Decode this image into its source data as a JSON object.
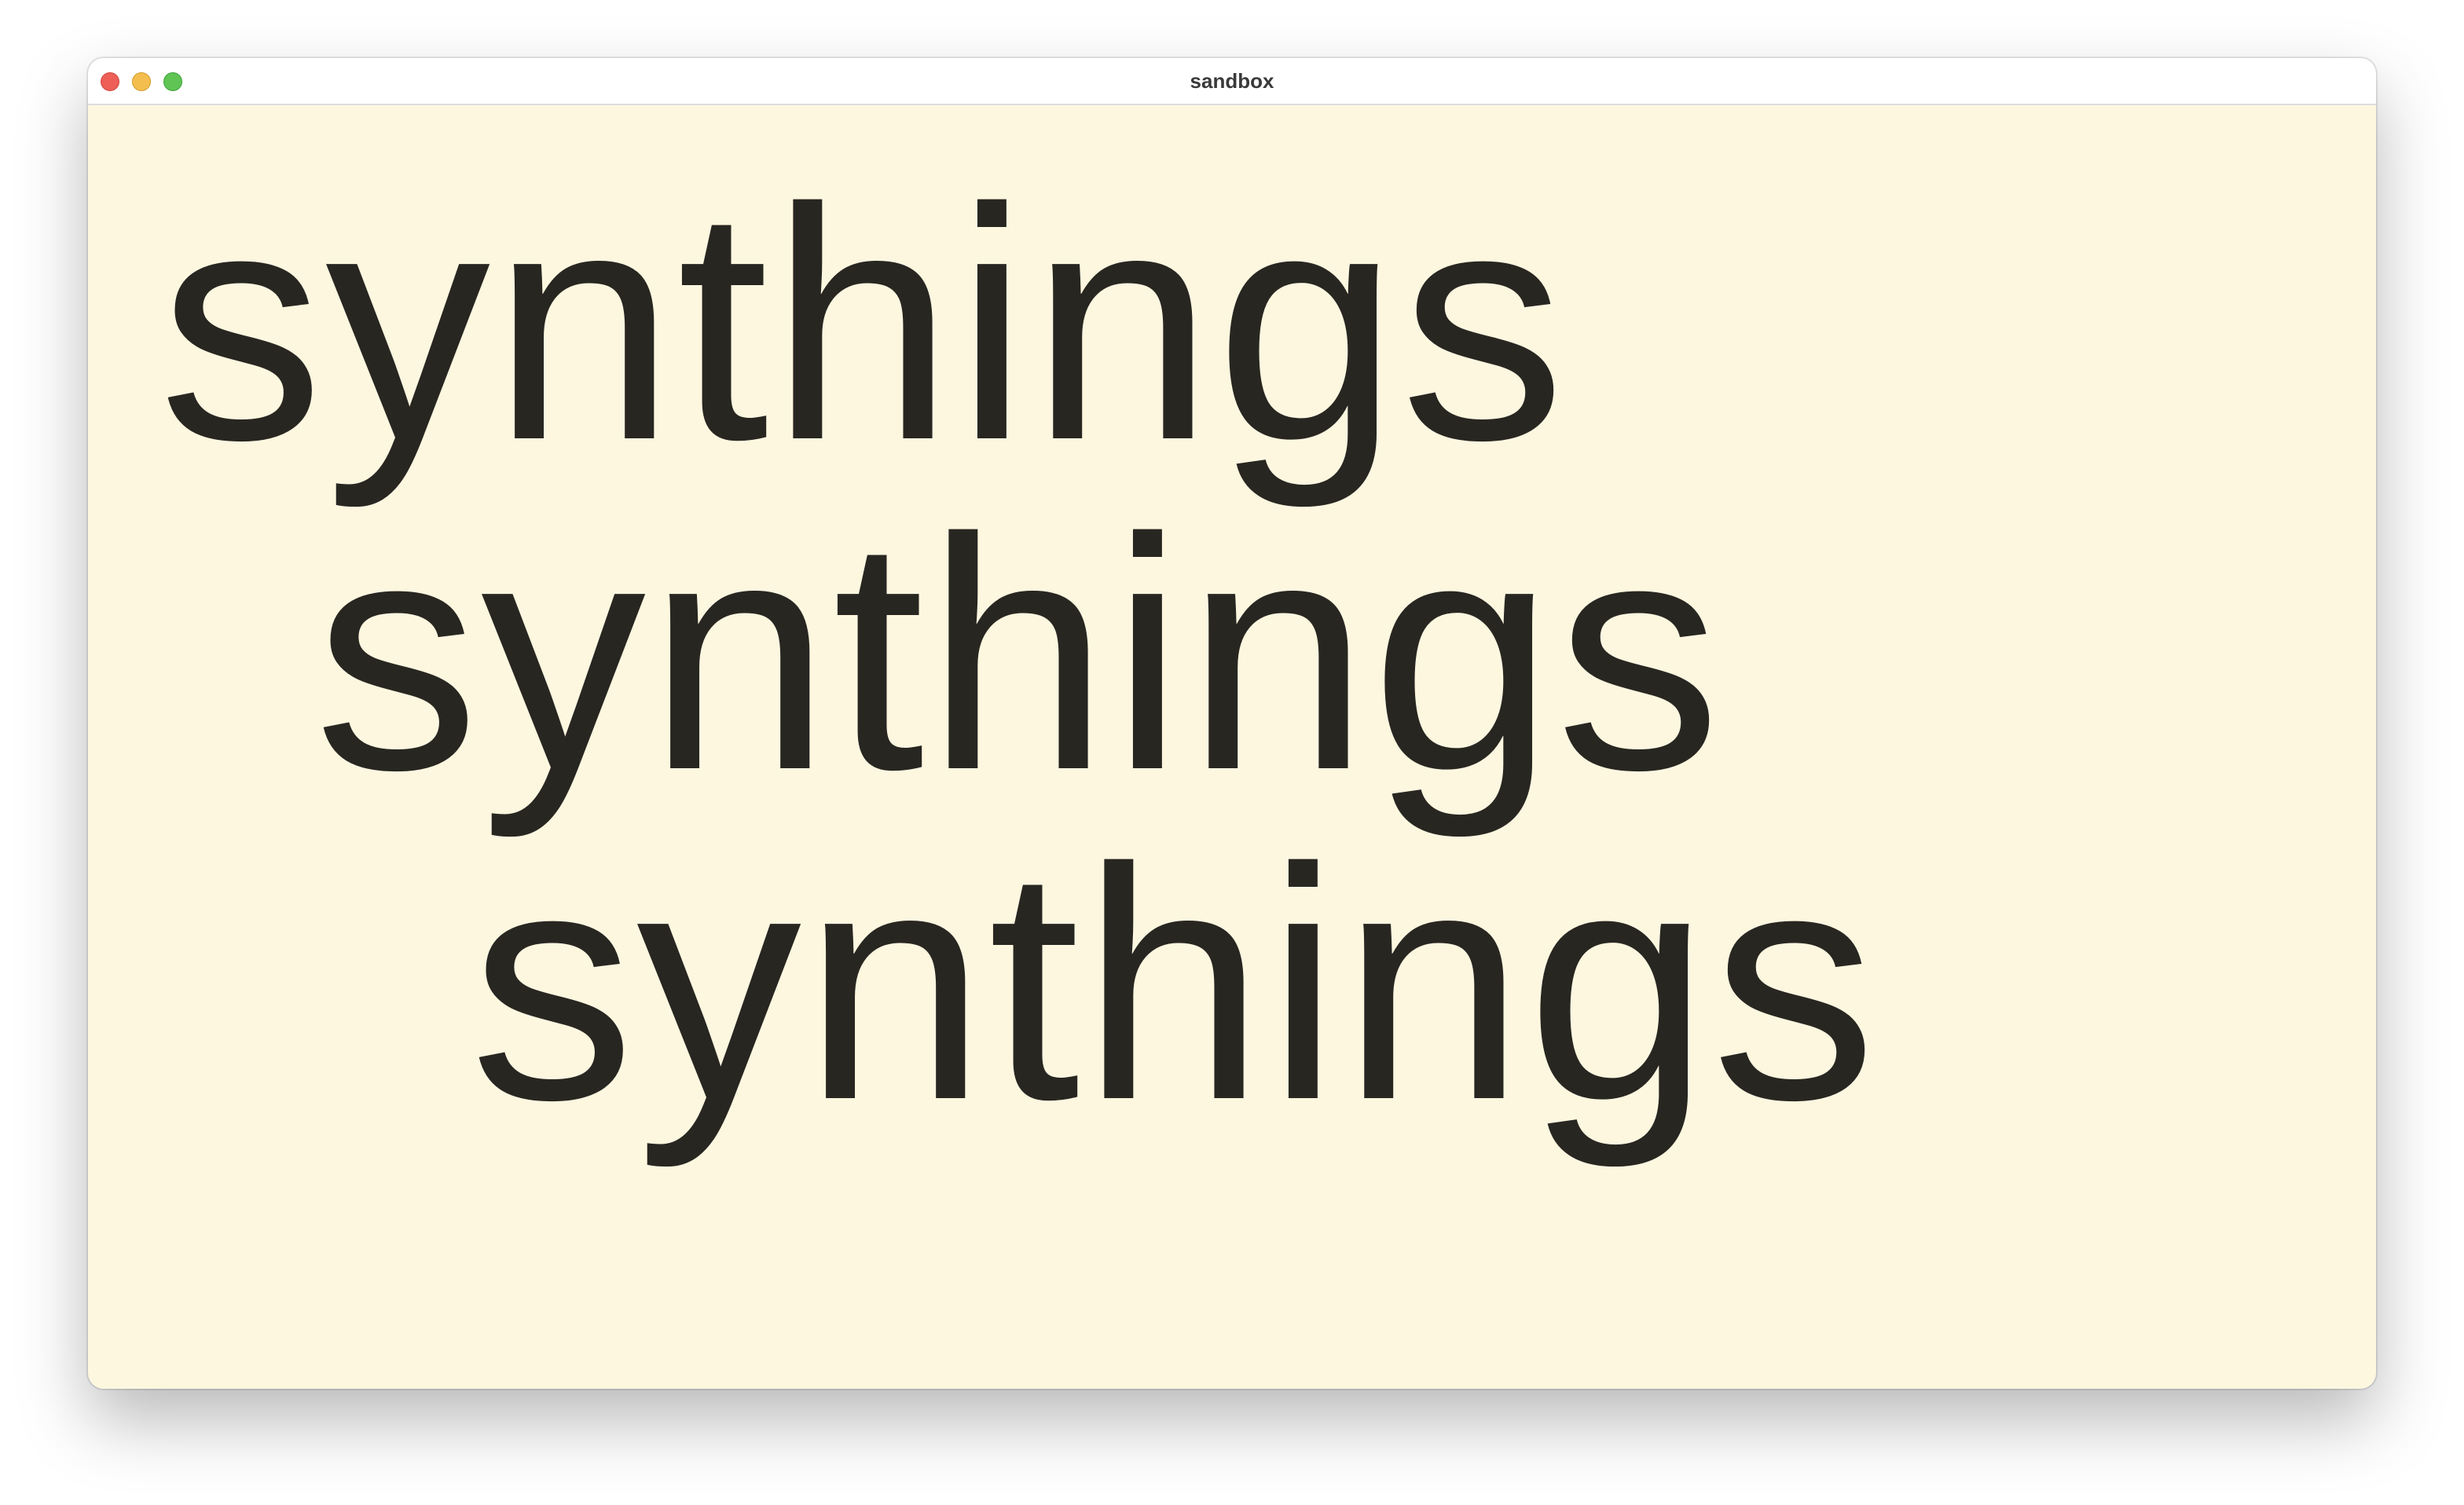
{
  "window": {
    "title": "sandbox",
    "background": "#fdf7e0",
    "controls": {
      "close_color": "#ed5f57",
      "minimize_color": "#f4be4f",
      "maximize_color": "#5fc454"
    }
  },
  "content": {
    "text_color": "#282621",
    "lines": [
      "synthings",
      "synthings",
      "synthings"
    ]
  }
}
